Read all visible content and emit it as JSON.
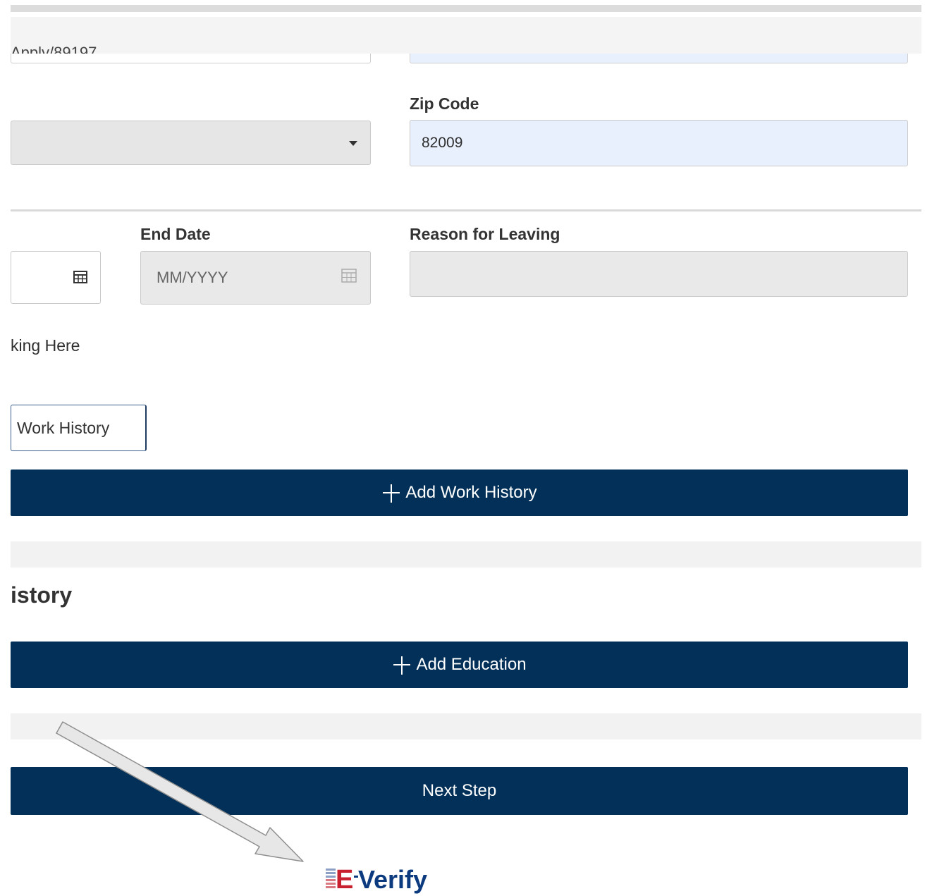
{
  "browser": {
    "url_fragment": "Apply/89197"
  },
  "address": {
    "zip_label": "Zip Code",
    "zip_value": "82009"
  },
  "work_history": {
    "end_date_label": "End Date",
    "end_date_placeholder": "MM/YYYY",
    "reason_label": "Reason for Leaving",
    "currently_working_text": "king Here",
    "remove_button_label": "Work History",
    "add_button_label": "Add Work History"
  },
  "education": {
    "heading": "istory",
    "add_button_label": "Add Education"
  },
  "actions": {
    "next_step_label": "Next Step"
  },
  "logo": {
    "text": "E-Verify",
    "colors": {
      "navy": "#0b3a7e",
      "red": "#c8202f"
    }
  },
  "colors": {
    "primary_button": "#023058",
    "autofill_bg": "#e8f0fe",
    "disabled_bg": "#e9e9e9"
  }
}
